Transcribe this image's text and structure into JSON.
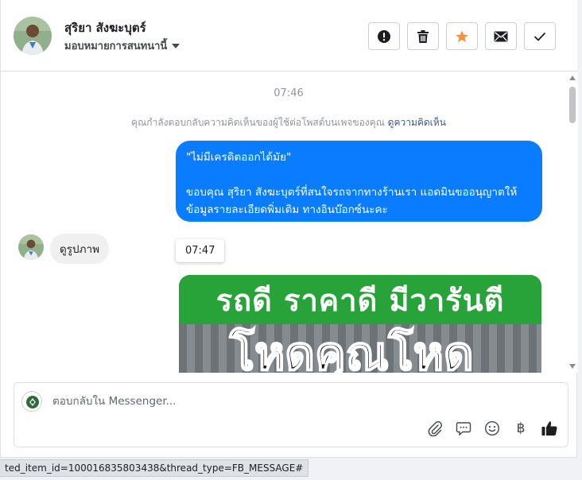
{
  "header": {
    "contact_name": "สุริยา สังฆะบุตร์",
    "assign_label": "มอบหมายการสนทนานี้"
  },
  "thread": {
    "timestamp_1": "07:46",
    "note_text": "คุณกำลังตอบกลับความคิดเห็นของผู้ใช้ต่อโพสต์บนเพจของคุณ",
    "note_link": "ดูความคิดเห็น",
    "outgoing_quote": "\"ไม่มีเครดิตออกได้มัย\"",
    "outgoing_reply": "ขอบคุณ สุริยา สังฆะบุตร์ที่สนใจรถจากทางร้านเรา แอดมินขออนุญาตให้ข้อมูลรายละเอียดพิ่มเติม ทางอินบ๊อกซ์นะคะ",
    "incoming_message": "ดูรูปภาพ",
    "timestamp_2": "07:47",
    "image_banner_text": "รถดี ราคาดี มีวารันตี",
    "image_overlay_text": "โหดคุณโหด"
  },
  "composer": {
    "placeholder": "ตอบกลับใน Messenger...",
    "currency_symbol": "฿"
  },
  "statusbar": {
    "url_text": "ted_item_id=100016835803438&thread_type=FB_MESSAGE#"
  },
  "colors": {
    "outgoing_bubble": "#0a7cff",
    "incoming_bubble": "#f0f0f0",
    "star": "#f7923b",
    "link": "#365899"
  }
}
